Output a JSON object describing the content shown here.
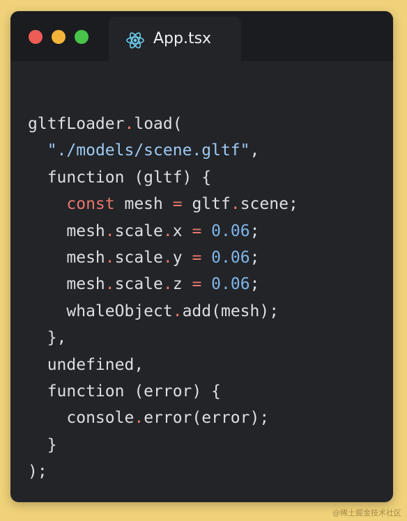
{
  "window": {
    "tab": {
      "label": "App.tsx",
      "icon": "react-icon"
    },
    "traffic_lights": {
      "close_color": "#ee5d55",
      "minimize_color": "#f4b43a",
      "maximize_color": "#47c449"
    }
  },
  "colors": {
    "background": "#f0d27a",
    "editor_bg": "#222428",
    "titlebar_bg": "#1b1c20",
    "text": "#dcdfe4",
    "keyword": "#e9776c",
    "string": "#9fc9f2",
    "number": "#7fb6ea"
  },
  "code": {
    "language": "tsx",
    "lines": [
      [
        {
          "t": "gltfLoader",
          "k": "plain"
        },
        {
          "t": ".",
          "k": "dot"
        },
        {
          "t": "load(",
          "k": "plain"
        }
      ],
      [
        {
          "t": "  ",
          "k": "plain"
        },
        {
          "t": "\"./models/scene.gltf\"",
          "k": "str"
        },
        {
          "t": ",",
          "k": "plain"
        }
      ],
      [
        {
          "t": "  function (gltf) {",
          "k": "plain"
        }
      ],
      [
        {
          "t": "    ",
          "k": "plain"
        },
        {
          "t": "const",
          "k": "kw"
        },
        {
          "t": " mesh ",
          "k": "plain"
        },
        {
          "t": "=",
          "k": "op"
        },
        {
          "t": " gltf",
          "k": "plain"
        },
        {
          "t": ".",
          "k": "dot"
        },
        {
          "t": "scene;",
          "k": "plain"
        }
      ],
      [
        {
          "t": "    mesh",
          "k": "plain"
        },
        {
          "t": ".",
          "k": "dot"
        },
        {
          "t": "scale",
          "k": "plain"
        },
        {
          "t": ".",
          "k": "dot"
        },
        {
          "t": "x ",
          "k": "plain"
        },
        {
          "t": "=",
          "k": "op"
        },
        {
          "t": " ",
          "k": "plain"
        },
        {
          "t": "0.06",
          "k": "num"
        },
        {
          "t": ";",
          "k": "plain"
        }
      ],
      [
        {
          "t": "    mesh",
          "k": "plain"
        },
        {
          "t": ".",
          "k": "dot"
        },
        {
          "t": "scale",
          "k": "plain"
        },
        {
          "t": ".",
          "k": "dot"
        },
        {
          "t": "y ",
          "k": "plain"
        },
        {
          "t": "=",
          "k": "op"
        },
        {
          "t": " ",
          "k": "plain"
        },
        {
          "t": "0.06",
          "k": "num"
        },
        {
          "t": ";",
          "k": "plain"
        }
      ],
      [
        {
          "t": "    mesh",
          "k": "plain"
        },
        {
          "t": ".",
          "k": "dot"
        },
        {
          "t": "scale",
          "k": "plain"
        },
        {
          "t": ".",
          "k": "dot"
        },
        {
          "t": "z ",
          "k": "plain"
        },
        {
          "t": "=",
          "k": "op"
        },
        {
          "t": " ",
          "k": "plain"
        },
        {
          "t": "0.06",
          "k": "num"
        },
        {
          "t": ";",
          "k": "plain"
        }
      ],
      [
        {
          "t": "    whaleObject",
          "k": "plain"
        },
        {
          "t": ".",
          "k": "dot"
        },
        {
          "t": "add(mesh);",
          "k": "plain"
        }
      ],
      [
        {
          "t": "  },",
          "k": "plain"
        }
      ],
      [
        {
          "t": "  undefined,",
          "k": "plain"
        }
      ],
      [
        {
          "t": "  function (error) {",
          "k": "plain"
        }
      ],
      [
        {
          "t": "    console",
          "k": "plain"
        },
        {
          "t": ".",
          "k": "dot"
        },
        {
          "t": "error(error);",
          "k": "plain"
        }
      ],
      [
        {
          "t": "  }",
          "k": "plain"
        }
      ],
      [
        {
          "t": ");",
          "k": "plain"
        }
      ]
    ]
  },
  "watermark": "@稀土掘金技术社区"
}
